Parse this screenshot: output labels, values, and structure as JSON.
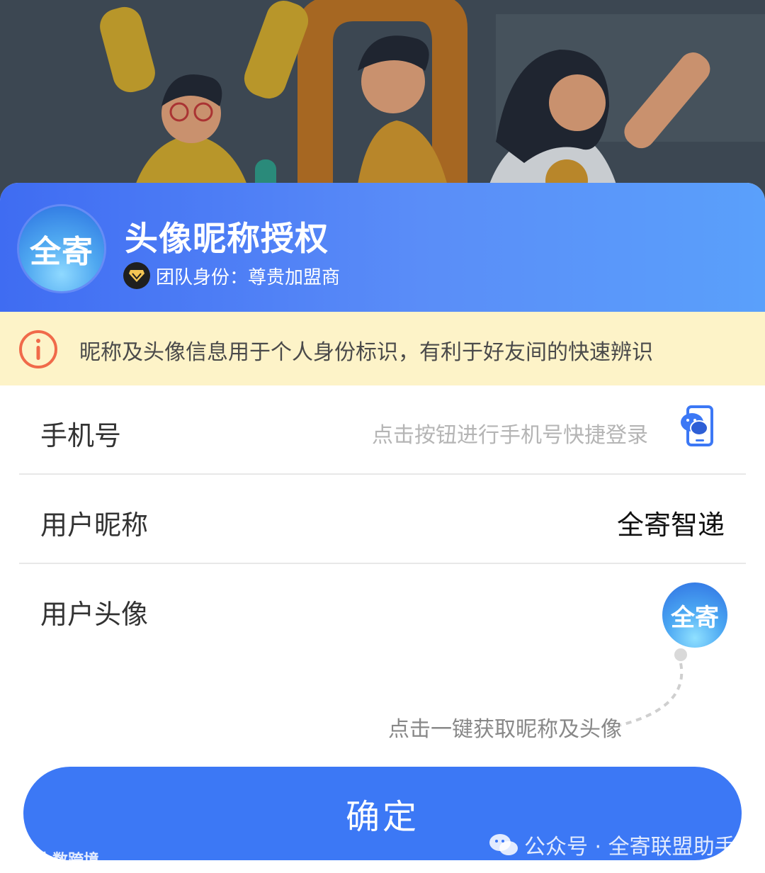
{
  "header": {
    "logo_text": "全寄",
    "title": "头像昵称授权",
    "team_identity": "团队身份：尊贵加盟商"
  },
  "notice": {
    "text": "昵称及头像信息用于个人身份标识，有利于好友间的快速辨识"
  },
  "form": {
    "phone": {
      "label": "手机号",
      "placeholder": "点击按钮进行手机号快捷登录"
    },
    "nickname": {
      "label": "用户昵称",
      "value": "全寄智递"
    },
    "avatar": {
      "label": "用户头像",
      "avatar_text": "全寄",
      "hint": "点击一键获取昵称及头像"
    }
  },
  "confirm_button": "确定",
  "watermarks": {
    "wechat": "公众号 · 全寄联盟助手",
    "corner": "大数跨境"
  },
  "colors": {
    "header_gradient_start": "#3f6cf2",
    "header_gradient_end": "#5aa0fb",
    "notice_bg": "#fdf3c8",
    "notice_icon": "#f06a4a",
    "button": "#3c78f5"
  },
  "icons": {
    "badge": "diamond-icon",
    "notice": "info-circle-icon",
    "phone": "wechat-phone-icon"
  }
}
